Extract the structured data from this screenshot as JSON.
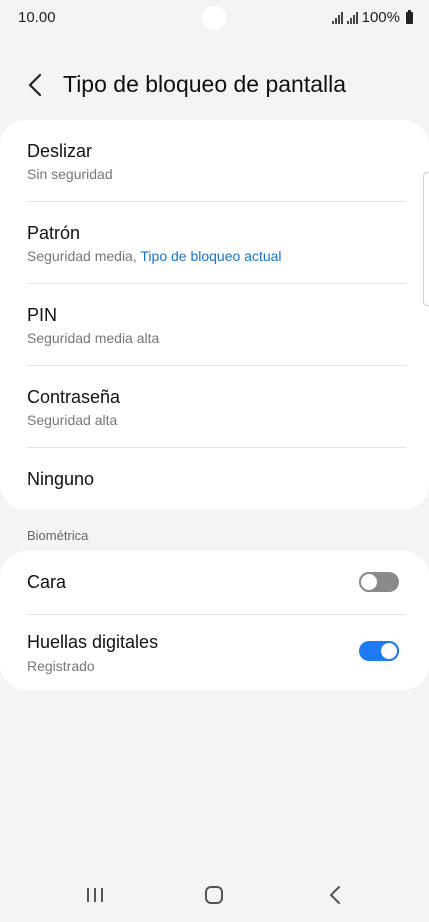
{
  "status_bar": {
    "time": "10.00",
    "battery": "100%"
  },
  "header": {
    "title": "Tipo de bloqueo de pantalla"
  },
  "lock_options": [
    {
      "title": "Deslizar",
      "subtitle": "Sin seguridad"
    },
    {
      "title": "Patrón",
      "subtitle": "Seguridad media,",
      "subtitle_accent": "Tipo de bloqueo actual"
    },
    {
      "title": "PIN",
      "subtitle": "Seguridad media alta"
    },
    {
      "title": "Contraseña",
      "subtitle": "Seguridad alta"
    },
    {
      "title": "Ninguno"
    }
  ],
  "biometrics": {
    "section_label": "Biométrica",
    "items": [
      {
        "title": "Cara",
        "enabled": false
      },
      {
        "title": "Huellas digitales",
        "subtitle": "Registrado",
        "enabled": true
      }
    ]
  },
  "colors": {
    "accent": "#1a73c8",
    "toggle_on": "#1d7af0",
    "background": "#f4f4f4",
    "card": "#ffffff"
  },
  "icons": {
    "back": "chevron-left-icon",
    "nav_recents": "recents-icon",
    "nav_home": "home-icon",
    "nav_back": "back-icon"
  }
}
